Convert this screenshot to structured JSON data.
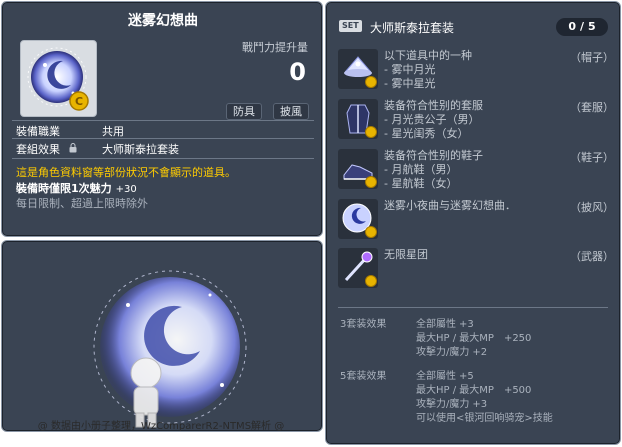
{
  "item_id": "01103127",
  "item": {
    "name": "迷雾幻想曲",
    "power_label": "戰鬥力提升量",
    "power_value": "0",
    "tags": [
      "防具",
      "披風"
    ],
    "job_label": "裝備職業",
    "job_value": "共用",
    "set_effect_label": "套組效果",
    "set_effect_value": "大师斯泰拉套装",
    "warning": "這是角色資料窗等部份狀況不會顯示的道具。",
    "charm_label": "裝備時僅限1次魅力",
    "charm_value": "+30",
    "limit_note": "每日限制、超過上限時除外"
  },
  "footer": "@ 数据由小册子整理，WzComparerR2-NTMS解析 @",
  "set": {
    "badge": "SET",
    "name": "大师斯泰拉套装",
    "count_current": "0",
    "count_sep": "/",
    "count_total": "5",
    "parts": [
      {
        "title": "以下道具中的一种",
        "lines": [
          "- 雾中月光",
          "- 雾中星光"
        ],
        "type": "（帽子）",
        "icon": "hat-icon"
      },
      {
        "title": "装备符合性别的套服",
        "lines": [
          "- 月光贵公子（男）",
          "- 星光闺秀（女）"
        ],
        "type": "（套服）",
        "icon": "overall-icon"
      },
      {
        "title": "装备符合性别的鞋子",
        "lines": [
          "- 月航鞋（男）",
          "- 星航鞋（女）"
        ],
        "type": "（鞋子）",
        "icon": "shoes-icon"
      },
      {
        "title": "迷雾小夜曲与迷雾幻想曲．",
        "lines": [],
        "type": "（披风）",
        "icon": "cape-icon"
      },
      {
        "title": "无限星团",
        "lines": [],
        "type": "（武器）",
        "icon": "weapon-icon"
      }
    ],
    "bonuses": [
      {
        "label": "3套装效果",
        "lines": [
          {
            "text": "全部屬性",
            "value": "+3"
          },
          {
            "text": "最大HP / 最大MP",
            "value": "+250"
          },
          {
            "text": "攻擊力/魔力",
            "value": "+2"
          }
        ]
      },
      {
        "label": "5套装效果",
        "lines": [
          {
            "text": "全部屬性",
            "value": "+5"
          },
          {
            "text": "最大HP / 最大MP",
            "value": "+500"
          },
          {
            "text": "攻擊力/魔力",
            "value": "+3"
          },
          {
            "text": "可以使用<银河回响骑宠>技能",
            "value": ""
          }
        ]
      }
    ]
  },
  "colors": {
    "panel_bg": "#3a4453",
    "warning": "#ffcc00",
    "dim_text": "#aab2bd",
    "gold_coin": "#e8b400"
  }
}
